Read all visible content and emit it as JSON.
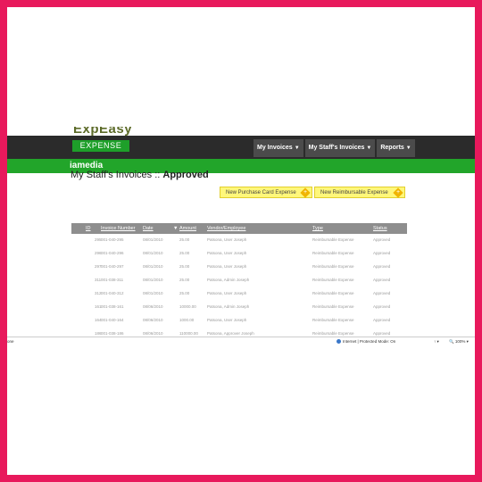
{
  "app": {
    "logo_top": "ExpEasy",
    "logo_expense": "EXPENSE",
    "company": "iamedia"
  },
  "nav": [
    {
      "label": "My Invoices"
    },
    {
      "label": "My Staff's Invoices"
    },
    {
      "label": "Reports"
    }
  ],
  "page": {
    "title_prefix": "My Staff's Invoices :: ",
    "title_status": "Approved"
  },
  "buttons": {
    "purchase_card": "New Purchase Card Expense",
    "reimbursable": "New Reimbursable Expense"
  },
  "table": {
    "headers": [
      "ID",
      "Invoice Number",
      "Date",
      "Amount",
      "Vendor/Employee",
      "Type",
      "Status"
    ],
    "rows": [
      [
        "295",
        "001-040-295",
        "08/01/2010",
        "25.00",
        "Patsona, User Joseph",
        "Reimbursable Expense",
        "Approved"
      ],
      [
        "296",
        "001-040-296",
        "08/01/2010",
        "25.00",
        "Patsona, User Joseph",
        "Reimbursable Expense",
        "Approved"
      ],
      [
        "297",
        "001-040-297",
        "08/01/2010",
        "25.00",
        "Patsona, User Joseph",
        "Reimbursable Expense",
        "Approved"
      ],
      [
        "311",
        "001-038-311",
        "08/01/2010",
        "25.00",
        "Patsona, Admin Joseph",
        "Reimbursable Expense",
        "Approved"
      ],
      [
        "312",
        "001-040-312",
        "08/01/2010",
        "25.00",
        "Patsona, User Joseph",
        "Reimbursable Expense",
        "Approved"
      ],
      [
        "161",
        "001-038-161",
        "08/06/2010",
        "10000.00",
        "Patsona, Admin Joseph",
        "Reimbursable Expense",
        "Approved"
      ],
      [
        "164",
        "001-040-164",
        "08/06/2010",
        "1000.00",
        "Patsona, User Joseph",
        "Reimbursable Expense",
        "Approved"
      ],
      [
        "186",
        "001-038-186",
        "08/06/2010",
        "110000.00",
        "Patsona, Approver Joseph",
        "Reimbursable Expense",
        "Approved"
      ]
    ]
  },
  "statusbar": {
    "left": "one",
    "security": "Internet | Protected Mode: On",
    "zoom": "100%"
  },
  "colors": {
    "frame": "#e8195c",
    "header_dark": "#2b2b2b",
    "brand_green": "#22a52a",
    "button_yellow": "#fff77a",
    "table_header": "#8e8e8e"
  }
}
